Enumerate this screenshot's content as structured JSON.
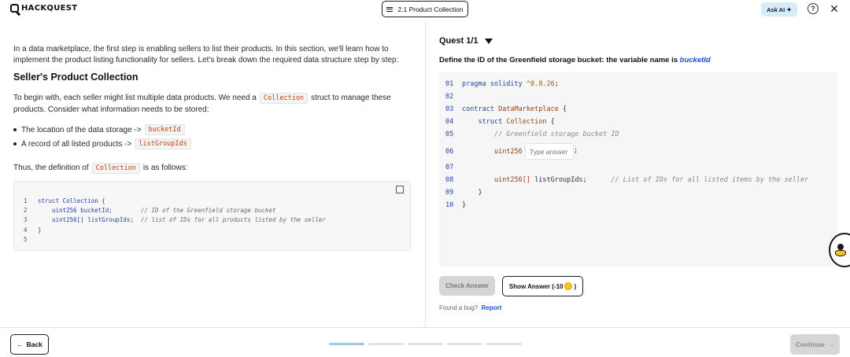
{
  "header": {
    "logo_text": "HACKQUEST",
    "unit_label": "2.1 Product Collection",
    "ask_ai_label": "Ask AI",
    "help_icon": "question-circle-icon",
    "close_icon": "close-icon"
  },
  "lesson": {
    "intro": "In a data marketplace, the first step is enabling sellers to list their products. In this section, we'll learn how to implement the product listing functionality for sellers. Let's break down the required data structure step by step:",
    "heading": "Seller's Product Collection",
    "para_before": "To begin with, each seller might list multiple data products. We need a",
    "para_code": "Collection",
    "para_after": "struct to manage these products. Consider what information needs to be stored:",
    "bullets": [
      {
        "text": "The location of the data storage ->",
        "code": "bucketId"
      },
      {
        "text": "A record of all listed products ->",
        "code": "listGroupIds"
      }
    ],
    "thus_text": "Thus, the definition of",
    "thus_code": "Collection",
    "thus_after": "is as follows:",
    "code_block": [
      {
        "num": "1",
        "code": "struct Collection {",
        "comment": ""
      },
      {
        "num": "2",
        "code": "    uint256 bucketId;        ",
        "comment": "// ID of the Greenfield storage bucket"
      },
      {
        "num": "3",
        "code": "    uint256[] listGroupIds;  ",
        "comment": "// list of IDs for all products listed by the seller"
      },
      {
        "num": "4",
        "code": "}",
        "comment": ""
      },
      {
        "num": "5",
        "code": "",
        "comment": ""
      }
    ]
  },
  "quest": {
    "title": "Quest 1/1",
    "prompt": "Define the ID of the Greenfield storage bucket: the variable name is",
    "variable": "bucketId",
    "lines": {
      "l1_num": "01",
      "l1_kw": "pragma solidity",
      "l1_ver": "^0.8.26",
      "l2_num": "02",
      "l3_num": "03",
      "l3_kw": "contract",
      "l3_name": "DataMarketplace",
      "l4_num": "04",
      "l4_kw": "struct",
      "l4_name": "Collection",
      "l5_num": "05",
      "l5_cmt": "// Greenfield storage bucket ID",
      "l6_num": "06",
      "l6_type": "uint256",
      "l7_num": "07",
      "l8_num": "08",
      "l8_type": "uint256[]",
      "l8_var": "listGroupIds;",
      "l8_cmt": "// List of IDs for all listed items by the seller",
      "l9_num": "09",
      "l10_num": "10"
    },
    "answer_placeholder": "Type answer",
    "check_label": "Check Answer",
    "show_label": "Show Answer (-10",
    "show_suffix": ")",
    "bug_text": "Found a bug?",
    "report_label": "Report"
  },
  "footer": {
    "back_label": "Back",
    "continue_label": "Continue",
    "progress": {
      "current": 1,
      "total": 5
    }
  },
  "colors": {
    "accent_blue": "#1d4ed8",
    "progress_active": "#9cc8ea",
    "ask_ai_bg": "#d7ecfb"
  }
}
